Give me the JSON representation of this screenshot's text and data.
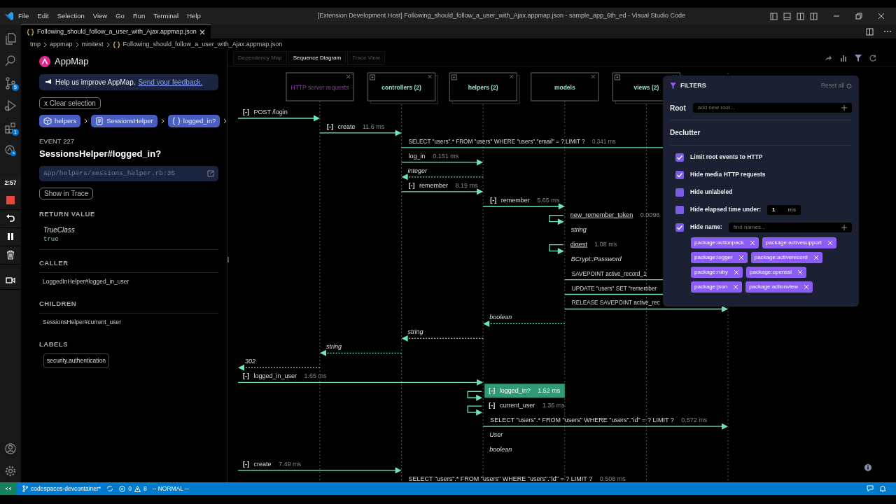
{
  "window": {
    "title": "[Extension Development Host] Following_should_follow_a_user_with_Ajax.appmap.json - sample_app_6th_ed - Visual Studio Code"
  },
  "menu": [
    "File",
    "Edit",
    "Selection",
    "View",
    "Go",
    "Run",
    "Terminal",
    "Help"
  ],
  "activity_bar": {
    "source_control_badge": "5",
    "extensions_badge": "1",
    "timer": "2:57"
  },
  "editor_tabs": [
    {
      "label": "Following_should_follow_a_user_with_Ajax.appmap.json",
      "selected": true
    }
  ],
  "breadcrumbs": [
    "tmp",
    "appmap",
    "minitest",
    "Following_should_follow_a_user_with_Ajax.appmap.json"
  ],
  "sidebar": {
    "title": "AppMap",
    "feedback": {
      "text": "Help us improve AppMap.",
      "link": "Send your feedback."
    },
    "clear_button": "x Clear selection",
    "path": [
      {
        "kind": "package",
        "label": "helpers"
      },
      {
        "kind": "class",
        "label": "SessionsHelper"
      },
      {
        "kind": "function",
        "label": "logged_in?"
      }
    ],
    "event_label": "EVENT 227",
    "event_title": "SessionsHelper#logged_in?",
    "location": "app/helpers/sessions_helper.rb:35",
    "show_in_trace": "Show in Trace",
    "return_value": {
      "heading": "RETURN VALUE",
      "class_name": "TrueClass",
      "value": "true"
    },
    "sections": [
      {
        "heading": "CALLER",
        "kind": "list",
        "items": [
          "LoggedInHelper#logged_in_user"
        ]
      },
      {
        "heading": "CHILDREN",
        "kind": "list",
        "items": [
          "SessionsHelper#current_user"
        ]
      },
      {
        "heading": "LABELS",
        "kind": "tags",
        "items": [
          "security.authentication"
        ]
      }
    ]
  },
  "view_tabs": [
    {
      "label": "Dependency Map",
      "selected": false
    },
    {
      "label": "Sequence Diagram",
      "selected": true
    },
    {
      "label": "Trace View",
      "selected": false
    }
  ],
  "lanes": [
    {
      "kind": "http",
      "label": "HTTP server requests",
      "expandable": false
    },
    {
      "kind": "controllers",
      "label": "controllers (2)",
      "expandable": true
    },
    {
      "kind": "helpers",
      "label": "helpers (2)",
      "expandable": true
    },
    {
      "kind": "models",
      "label": "models",
      "expandable": false
    },
    {
      "kind": "views",
      "label": "views (2)",
      "expandable": true
    },
    {
      "kind": "database"
    }
  ],
  "messages": [
    {
      "kind": "call",
      "source": {
        "kind": "client"
      },
      "target": {
        "kind": "http"
      },
      "toggle": "[-]",
      "name": "POST /login",
      "selected": false
    },
    {
      "kind": "call",
      "source": {
        "kind": "http"
      },
      "target": {
        "kind": "controllers"
      },
      "toggle": "[-]",
      "name": "create",
      "elapsed": "11.6 ms",
      "selected": false
    },
    {
      "kind": "query",
      "source": {
        "kind": "controllers"
      },
      "target": {
        "kind": "database"
      },
      "name": "SELECT \"users\".* FROM \"users\" WHERE \"users\".\"email\" = ? LIMIT ?",
      "elapsed": "0.341 ms",
      "selected": false
    },
    {
      "kind": "call",
      "source": {
        "kind": "controllers"
      },
      "target": {
        "kind": "helpers"
      },
      "name": "log_in",
      "elapsed": "0.151 ms",
      "selected": false
    },
    {
      "kind": "return",
      "source": {
        "kind": "helpers"
      },
      "target": {
        "kind": "controllers"
      },
      "name": "integer",
      "selected": false
    },
    {
      "kind": "call",
      "source": {
        "kind": "controllers"
      },
      "target": {
        "kind": "helpers"
      },
      "toggle": "[-]",
      "name": "remember",
      "elapsed": "8.19 ms",
      "selected": false
    },
    {
      "kind": "call",
      "source": {
        "kind": "helpers"
      },
      "target": {
        "kind": "models"
      },
      "toggle": "[-]",
      "name": "remember",
      "elapsed": "5.65 ms",
      "selected": false
    },
    {
      "kind": "self",
      "source": {
        "kind": "models"
      },
      "target": {
        "kind": "models"
      },
      "name": "new_remember_token",
      "elapsed": "0.0096",
      "underlined": true,
      "selected": false
    },
    {
      "kind": "return",
      "source": {
        "kind": "models"
      },
      "target": {
        "kind": "models"
      },
      "name": "string",
      "selected": false
    },
    {
      "kind": "self",
      "source": {
        "kind": "models"
      },
      "target": {
        "kind": "models"
      },
      "name": "digest",
      "elapsed": "1.08 ms",
      "underlined": true,
      "selected": false
    },
    {
      "kind": "return",
      "source": {
        "kind": "models"
      },
      "target": {
        "kind": "models"
      },
      "name": "BCrypt::Password",
      "selected": false
    },
    {
      "kind": "query",
      "source": {
        "kind": "models"
      },
      "target": {
        "kind": "database"
      },
      "name": "SAVEPOINT active_record_1",
      "selected": false
    },
    {
      "kind": "query",
      "source": {
        "kind": "models"
      },
      "target": {
        "kind": "database"
      },
      "name": "UPDATE \"users\" SET \"remember",
      "selected": false
    },
    {
      "kind": "query",
      "source": {
        "kind": "models"
      },
      "target": {
        "kind": "database"
      },
      "name": "RELEASE SAVEPOINT active_rec",
      "selected": false
    },
    {
      "kind": "return",
      "source": {
        "kind": "models"
      },
      "target": {
        "kind": "helpers"
      },
      "name": "boolean",
      "selected": false
    },
    {
      "kind": "return",
      "source": {
        "kind": "helpers"
      },
      "target": {
        "kind": "controllers"
      },
      "name": "string",
      "selected": false
    },
    {
      "kind": "return",
      "source": {
        "kind": "controllers"
      },
      "target": {
        "kind": "http"
      },
      "name": "string",
      "selected": false
    },
    {
      "kind": "return",
      "source": {
        "kind": "http"
      },
      "target": {
        "kind": "client"
      },
      "name": "302",
      "selected": false
    },
    {
      "kind": "call",
      "source": {
        "kind": "client"
      },
      "target": {
        "kind": "helpers"
      },
      "toggle": "[-]",
      "name": "logged_in_user",
      "elapsed": "1.65 ms",
      "selected": false
    },
    {
      "kind": "self",
      "source": {
        "kind": "helpers"
      },
      "target": {
        "kind": "helpers"
      },
      "toggle": "[-]",
      "name": "logged_in?",
      "elapsed": "1.52 ms",
      "selected": true
    },
    {
      "kind": "self",
      "source": {
        "kind": "helpers"
      },
      "target": {
        "kind": "helpers"
      },
      "toggle": "[-]",
      "name": "current_user",
      "elapsed": "1.36 ms",
      "selected": false
    },
    {
      "kind": "query",
      "source": {
        "kind": "helpers"
      },
      "target": {
        "kind": "database"
      },
      "name": "SELECT \"users\".* FROM \"users\" WHERE \"users\".\"id\" = ? LIMIT ?",
      "elapsed": "0.572 ms",
      "selected": false
    },
    {
      "kind": "return",
      "source": {
        "kind": "helpers"
      },
      "target": {
        "kind": "helpers"
      },
      "name": "User",
      "selected": false
    },
    {
      "kind": "return",
      "source": {
        "kind": "helpers"
      },
      "target": {
        "kind": "helpers"
      },
      "name": "boolean",
      "selected": false
    },
    {
      "kind": "call",
      "source": {
        "kind": "client"
      },
      "target": {
        "kind": "controllers"
      },
      "toggle": "[-]",
      "name": "create",
      "elapsed": "7.49 ms",
      "selected": false
    },
    {
      "kind": "query",
      "source": {
        "kind": "controllers"
      },
      "target": {
        "kind": "database"
      },
      "name": "SELECT \"users\".* FROM \"users\" WHERE \"users\".\"id\" = ? LIMIT ?",
      "elapsed": "0.508 ms",
      "selected": false
    }
  ],
  "filters": {
    "title": "FILTERS",
    "reset": "Reset all",
    "root_label": "Root",
    "root_placeholder": "add new root...",
    "declutter": "Declutter",
    "options": [
      {
        "kind": "checkbox",
        "label": "Limit root events to HTTP",
        "checked": true
      },
      {
        "kind": "checkbox",
        "label": "Hide media HTTP requests",
        "checked": true
      },
      {
        "kind": "checkbox",
        "label": "Hide unlabeled",
        "checked": false
      },
      {
        "kind": "number",
        "label": "Hide elapsed time under:",
        "checked": false,
        "value": "1",
        "unit": "ms"
      },
      {
        "kind": "names",
        "label": "Hide name:",
        "checked": true,
        "placeholder": "find names..."
      }
    ],
    "tags": [
      "package:actionpack",
      "package:activesupport",
      "package:logger",
      "package:activerecord",
      "package:ruby",
      "package:openssl",
      "package:json",
      "package:actionview"
    ]
  },
  "status_bar": {
    "branch": "codespaces-devcontainer*",
    "errors": "0",
    "warnings": "8",
    "mode": "-- NORMAL --"
  }
}
